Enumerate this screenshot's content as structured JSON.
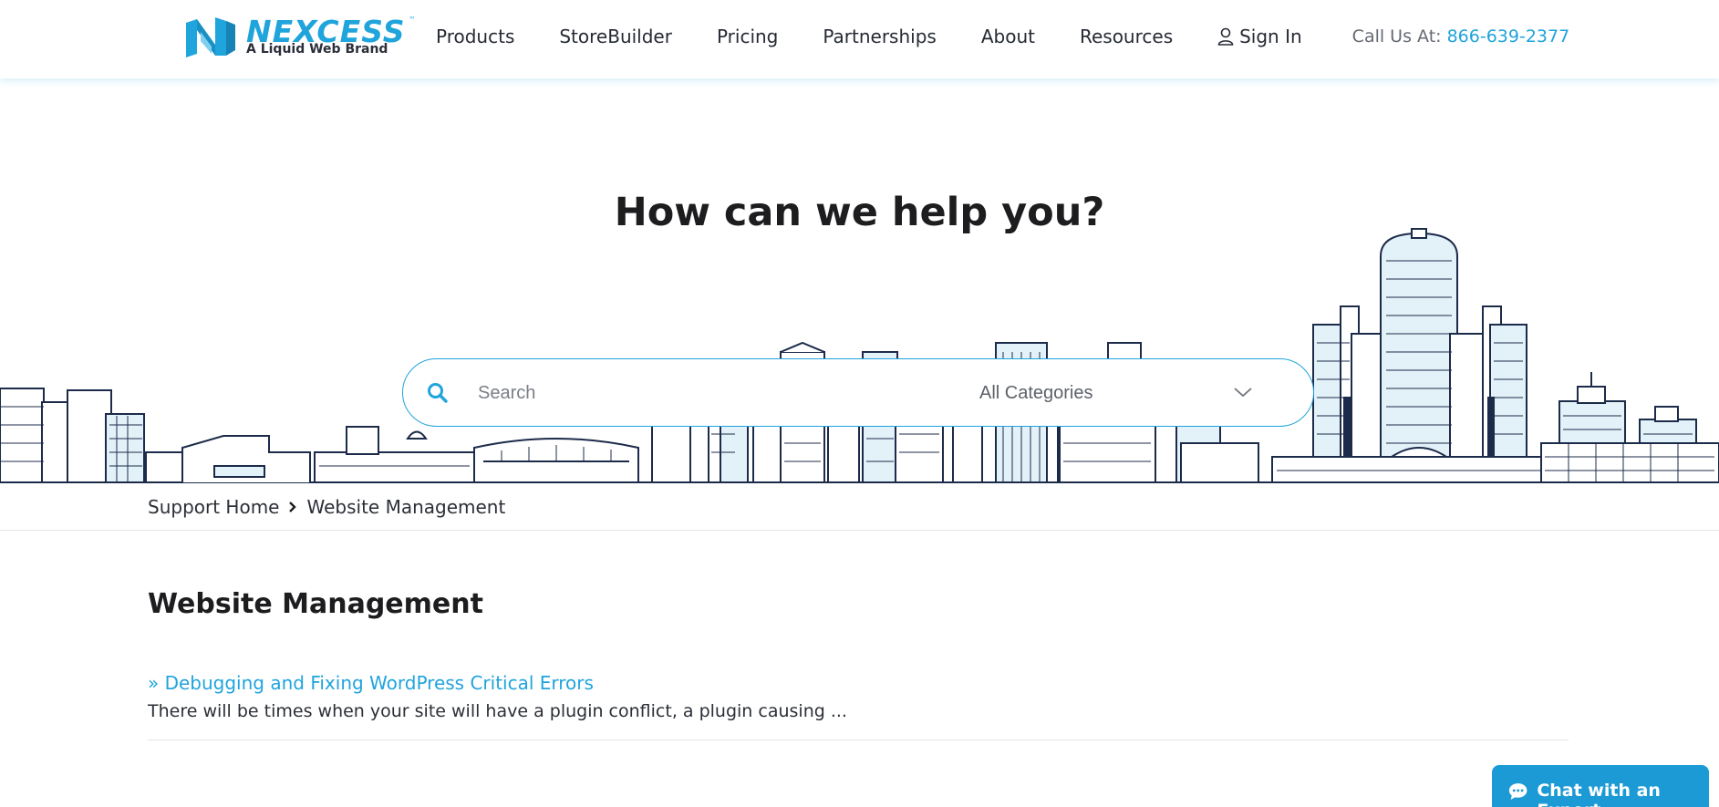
{
  "header": {
    "logo_word": "NEXCESS",
    "logo_tm": "™",
    "logo_sub": "A Liquid Web Brand",
    "nav": [
      "Products",
      "StoreBuilder",
      "Pricing",
      "Partnerships",
      "About",
      "Resources"
    ],
    "signin_label": "Sign In",
    "call_label": "Call Us At:",
    "phone": "866-639-2377"
  },
  "hero": {
    "title": "How can we help you?",
    "search_placeholder": "Search",
    "category_selected": "All Categories"
  },
  "breadcrumb": {
    "home": "Support Home",
    "current": "Website Management"
  },
  "section": {
    "title": "Website Management",
    "articles": [
      {
        "title": "» Debugging and Fixing WordPress Critical Errors",
        "excerpt": "There will be times when your site will have a plugin conflict, a plugin causing ..."
      }
    ]
  },
  "chat": {
    "label": "Chat with an Expert"
  },
  "colors": {
    "brand": "#20a4dc",
    "chat": "#1b9ad6",
    "skyline_stroke": "#1c2b4a",
    "skyline_fill": "#e3f1f9"
  }
}
